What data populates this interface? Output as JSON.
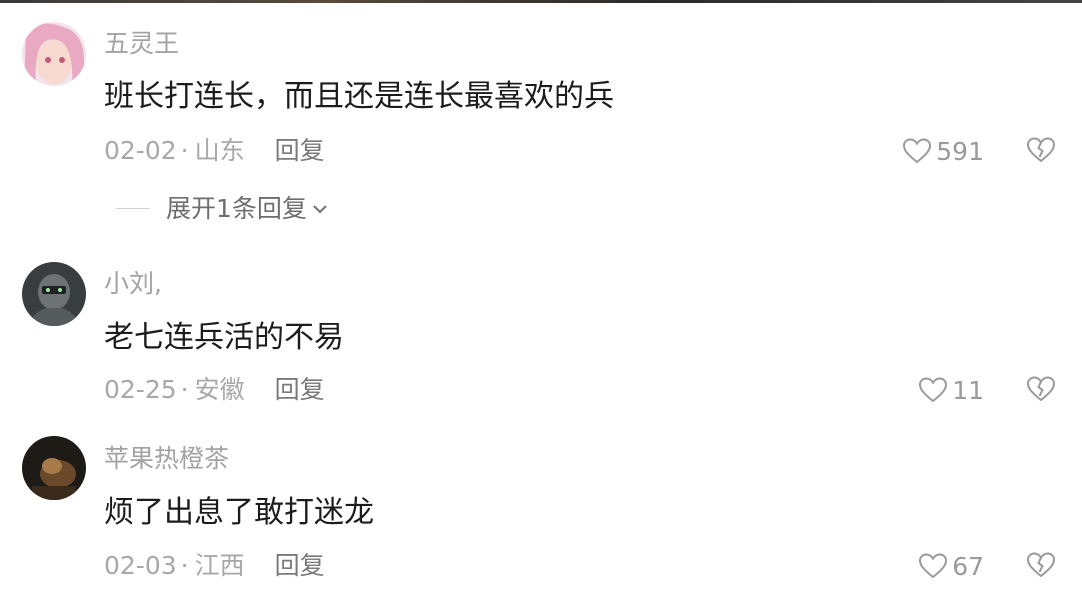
{
  "comments": [
    {
      "username": "五灵王",
      "text": "班长打连长，而且还是连长最喜欢的兵",
      "date": "02-02",
      "location": "山东",
      "reply_label": "回复",
      "likes": "591",
      "expand_label": "展开1条回复"
    },
    {
      "username": "小刘,",
      "text": "老七连兵活的不易",
      "date": "02-25",
      "location": "安徽",
      "reply_label": "回复",
      "likes": "11"
    },
    {
      "username": "苹果热橙茶",
      "text": "烦了出息了敢打迷龙",
      "date": "02-03",
      "location": "江西",
      "reply_label": "回复",
      "likes": "67"
    }
  ],
  "meta_separator": "·",
  "colors": {
    "text": "#1c1c1c",
    "muted": "#a3a3a3",
    "reply": "#7a7a7a"
  }
}
